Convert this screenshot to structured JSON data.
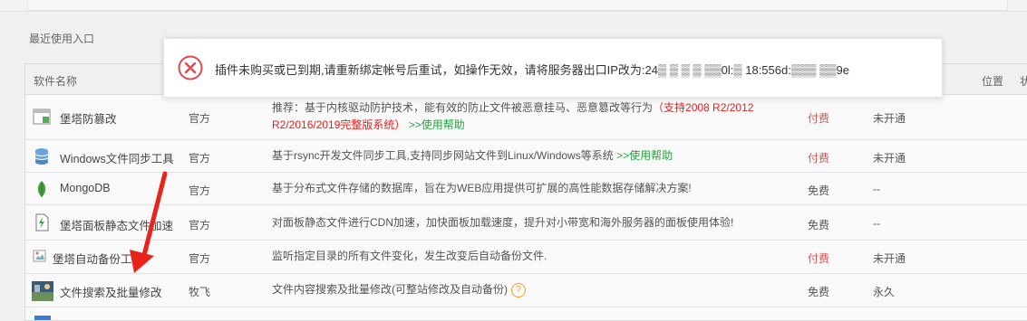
{
  "section_title": "最近使用入口",
  "table": {
    "headers": {
      "name": "软件名称",
      "position": "位置",
      "extra": "状"
    },
    "rows": [
      {
        "icon": "shield-icon",
        "name": "堡塔防篡改",
        "developer": "官方",
        "desc_main": "推荐：基于内核驱动防护技术，能有效的防止文件被恶意挂马、恶意篡改等行为",
        "desc_red": "（支持2008 R2/2012 R2/2016/2019完整版系统）",
        "desc_red_line1": "（支持2008 R2/2012",
        "desc_red_line2": "R2/2016/2019完整版系统）",
        "desc_help": ">>使用帮助",
        "price": "付费",
        "status": "未开通"
      },
      {
        "icon": "database-icon",
        "name": "Windows文件同步工具",
        "developer": "官方",
        "desc_main": "基于rsync开发文件同步工具,支持同步网站文件到Linux/Windows等系统",
        "desc_help": ">>使用帮助",
        "price": "付费",
        "status": "未开通"
      },
      {
        "icon": "leaf-icon",
        "name": "MongoDB",
        "developer": "官方",
        "desc_main": "基于分布式文件存储的数据库，旨在为WEB应用提供可扩展的高性能数据存储解决方案!",
        "price": "免费",
        "status": "--"
      },
      {
        "icon": "bolt-file-icon",
        "name": "堡塔面板静态文件加速",
        "developer": "官方",
        "desc_main": "对面板静态文件进行CDN加速，加快面板加载速度，提升对小带宽和海外服务器的面板使用体验!",
        "price": "免费",
        "status": "--"
      },
      {
        "icon": "broken-image-icon",
        "name": "堡塔自动备份工具",
        "developer": "官方",
        "desc_main": "监听指定目录的所有文件变化，发生改变后自动备份文件.",
        "price": "付费",
        "status": "未开通"
      },
      {
        "icon": "thumbnail-icon",
        "name": "文件搜索及批量修改",
        "developer": "牧飞",
        "desc_main": "文件内容搜索及批量修改(可整站修改及自动备份)",
        "help_glyph": "?",
        "price": "免费",
        "status": "永久"
      }
    ]
  },
  "toast": {
    "icon": "error-icon",
    "message": "插件未购买或已到期,请重新绑定帐号后重试，如操作无效，请将服务器出口IP改为:24▒ ▒ ▒ ▒ ▒▒0l:▒ 18:556d:▒▒▒ ▒▒9e"
  },
  "colors": {
    "paid": "#d9534f",
    "help_link": "#20a53a",
    "highlight": "#e02020",
    "error": "#e04a4a",
    "arrow": "#e8231c"
  }
}
